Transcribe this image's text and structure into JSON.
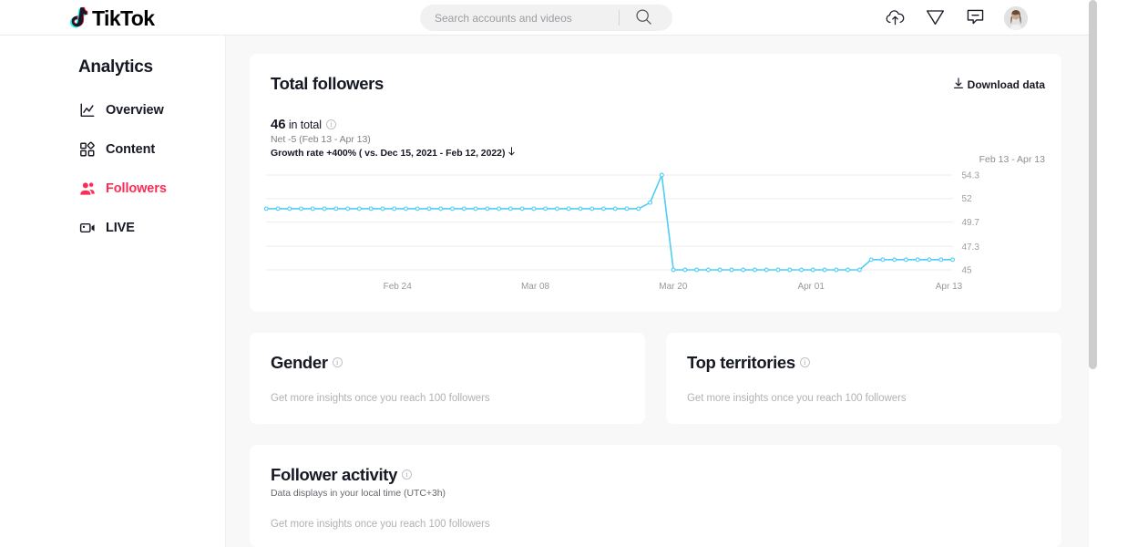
{
  "brand": {
    "name": "TikTok",
    "accent": "#fe2c55",
    "accent_secondary": "#25f4ee",
    "chart_line": "#4ecdf5"
  },
  "topnav": {
    "search": {
      "placeholder": "Search accounts and videos",
      "value": "",
      "icon": "search-icon"
    },
    "actions": [
      {
        "name": "upload-icon",
        "label": "Upload"
      },
      {
        "name": "send-icon",
        "label": "Send"
      },
      {
        "name": "message-icon",
        "label": "Messages"
      }
    ],
    "avatar_label": "Profile"
  },
  "sidebar": {
    "title": "Analytics",
    "items": [
      {
        "label": "Overview",
        "icon": "chart-line-icon",
        "active": false
      },
      {
        "label": "Content",
        "icon": "grid-squares-icon",
        "active": false
      },
      {
        "label": "Followers",
        "icon": "people-icon",
        "active": true
      },
      {
        "label": "LIVE",
        "icon": "video-camera-icon",
        "active": false
      }
    ]
  },
  "followers_card": {
    "title": "Total followers",
    "download_label": "Download data",
    "total_value": "46",
    "total_suffix": " in total",
    "net": "Net -5 (Feb 13 - Apr 13)",
    "growth": "Growth rate +400% ( vs. Dec 15, 2021 - Feb 12, 2022)",
    "date_range": "Feb 13 - Apr 13"
  },
  "gender_card": {
    "title": "Gender",
    "placeholder": "Get more insights once you reach 100 followers"
  },
  "territories_card": {
    "title": "Top territories",
    "placeholder": "Get more insights once you reach 100 followers"
  },
  "activity_card": {
    "title": "Follower activity",
    "subtitle": "Data displays in your local time (UTC+3h)",
    "placeholder": "Get more insights once you reach 100 followers"
  },
  "chart_data": {
    "type": "line",
    "title": "Total followers",
    "xlabel": "",
    "ylabel": "",
    "grid": true,
    "legend": false,
    "ylim": [
      45,
      54.3
    ],
    "yticks": [
      54.3,
      52,
      49.7,
      47.3,
      45
    ],
    "ytick_labels": [
      "54.3",
      "52",
      "49.7",
      "47.3",
      "45"
    ],
    "xticks": [
      "Feb 24",
      "Mar 08",
      "Mar 20",
      "Apr 01",
      "Apr 13"
    ],
    "x": [
      "Feb 13",
      "Feb 14",
      "Feb 15",
      "Feb 16",
      "Feb 17",
      "Feb 18",
      "Feb 19",
      "Feb 20",
      "Feb 21",
      "Feb 22",
      "Feb 23",
      "Feb 24",
      "Feb 25",
      "Feb 26",
      "Feb 27",
      "Feb 28",
      "Mar 01",
      "Mar 02",
      "Mar 03",
      "Mar 04",
      "Mar 05",
      "Mar 06",
      "Mar 07",
      "Mar 08",
      "Mar 09",
      "Mar 10",
      "Mar 11",
      "Mar 12",
      "Mar 13",
      "Mar 14",
      "Mar 15",
      "Mar 16",
      "Mar 17",
      "Mar 18",
      "Mar 19",
      "Mar 20",
      "Mar 21",
      "Mar 22",
      "Mar 23",
      "Mar 24",
      "Mar 25",
      "Mar 26",
      "Mar 27",
      "Mar 28",
      "Mar 29",
      "Mar 30",
      "Mar 31",
      "Apr 01",
      "Apr 02",
      "Apr 03",
      "Apr 04",
      "Apr 05",
      "Apr 06",
      "Apr 07",
      "Apr 08",
      "Apr 09",
      "Apr 10",
      "Apr 11",
      "Apr 12",
      "Apr 13"
    ],
    "values": [
      51,
      51,
      51,
      51,
      51,
      51,
      51,
      51,
      51,
      51,
      51,
      51,
      51,
      51,
      51,
      51,
      51,
      51,
      51,
      51,
      51,
      51,
      51,
      51,
      51,
      51,
      51,
      51,
      51,
      51,
      51,
      51,
      51,
      51.6,
      54.3,
      45,
      45,
      45,
      45,
      45,
      45,
      45,
      45,
      45,
      45,
      45,
      45,
      45,
      45,
      45,
      45,
      45,
      46,
      46,
      46,
      46,
      46,
      46,
      46,
      46
    ]
  }
}
